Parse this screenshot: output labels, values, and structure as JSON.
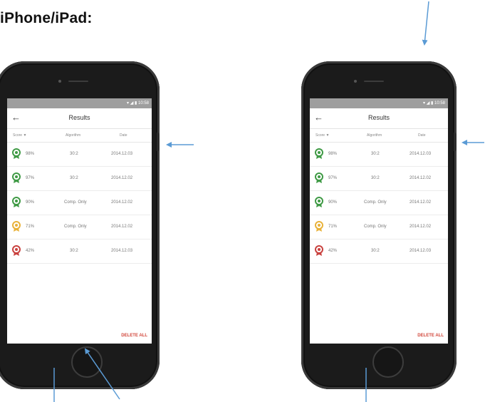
{
  "heading": "iPhone/iPad:",
  "phones": [
    {
      "status": "▾ ◢ ▮ 10:58",
      "title": "Results",
      "columns": [
        "Score ▼",
        "Algorithm",
        "Date"
      ],
      "rows": [
        {
          "score": "98%",
          "algorithm": "30:2",
          "date": "2014.12.03",
          "badge": "green"
        },
        {
          "score": "97%",
          "algorithm": "30:2",
          "date": "2014.12.02",
          "badge": "green"
        },
        {
          "score": "90%",
          "algorithm": "Comp. Only",
          "date": "2014.12.02",
          "badge": "green"
        },
        {
          "score": "71%",
          "algorithm": "Comp. Only",
          "date": "2014.12.02",
          "badge": "yellow"
        },
        {
          "score": "42%",
          "algorithm": "30:2",
          "date": "2014.12.03",
          "badge": "red"
        }
      ],
      "delete_all": "DELETE ALL"
    },
    {
      "status": "▾ ◢ ▮ 10:58",
      "title": "Results",
      "columns": [
        "Score ▼",
        "Algorithm",
        "Date"
      ],
      "rows": [
        {
          "score": "98%",
          "algorithm": "30:2",
          "date": "2014.12.03",
          "badge": "green"
        },
        {
          "score": "97%",
          "algorithm": "30:2",
          "date": "2014.12.02",
          "badge": "green"
        },
        {
          "score": "90%",
          "algorithm": "Comp. Only",
          "date": "2014.12.02",
          "badge": "green"
        },
        {
          "score": "71%",
          "algorithm": "Comp. Only",
          "date": "2014.12.02",
          "badge": "yellow"
        },
        {
          "score": "42%",
          "algorithm": "30:2",
          "date": "2014.12.03",
          "badge": "red"
        }
      ],
      "delete_all": "DELETE ALL"
    }
  ],
  "colors": {
    "green": "#3f9a45",
    "yellow": "#e9b23a",
    "red": "#c9423f",
    "arrow": "#5b9bd5"
  }
}
